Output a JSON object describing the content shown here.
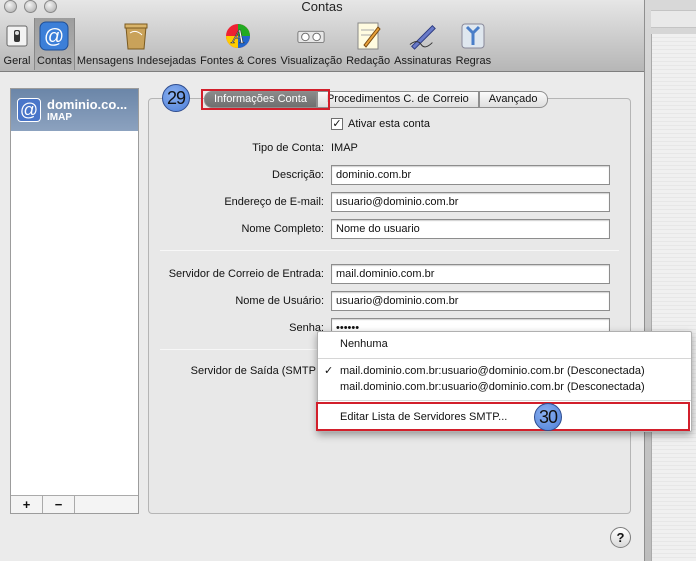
{
  "window": {
    "title": "Contas"
  },
  "toolbar": {
    "items": [
      {
        "label": "Geral",
        "icon": "switch-icon"
      },
      {
        "label": "Contas",
        "icon": "at-icon",
        "selected": true
      },
      {
        "label": "Mensagens Indesejadas",
        "icon": "trash-bin-icon"
      },
      {
        "label": "Fontes & Cores",
        "icon": "color-font-icon"
      },
      {
        "label": "Visualização",
        "icon": "glasses-icon"
      },
      {
        "label": "Redação",
        "icon": "compose-icon"
      },
      {
        "label": "Assinaturas",
        "icon": "pen-icon"
      },
      {
        "label": "Regras",
        "icon": "rules-icon"
      }
    ]
  },
  "sidebar": {
    "account": {
      "name": "dominio.co...",
      "type": "IMAP"
    },
    "add_label": "+",
    "remove_label": "−"
  },
  "badges": {
    "tab_step": "29",
    "menu_step": "30"
  },
  "tabs": [
    {
      "label": "Informações Conta",
      "active": true
    },
    {
      "label": "Procedimentos C. de Correio"
    },
    {
      "label": "Avançado"
    }
  ],
  "form": {
    "enable_label": "Ativar esta conta",
    "enable_checked": true,
    "account_type_label": "Tipo de Conta:",
    "account_type_value": "IMAP",
    "description_label": "Descrição:",
    "description_value": "dominio.com.br",
    "email_label": "Endereço de E-mail:",
    "email_value": "usuario@dominio.com.br",
    "fullname_label": "Nome Completo:",
    "fullname_value": "Nome do usuario",
    "incoming_label": "Servidor de Correio de Entrada:",
    "incoming_value": "mail.dominio.com.br",
    "username_label": "Nome de Usuário:",
    "username_value": "usuario@dominio.com.br",
    "password_label": "Senha:",
    "password_value": "••••••",
    "smtp_label": "Servidor de Saída (SMTP"
  },
  "smtp_menu": {
    "none": "Nenhuma",
    "selected_mark": "✓",
    "server1": "mail.dominio.com.br:usuario@dominio.com.br (Desconectada)",
    "server2": "mail.dominio.com.br:usuario@dominio.com.br (Desconectada)",
    "edit": "Editar Lista de Servidores SMTP..."
  },
  "help": "?",
  "colors": {
    "highlight": "#d21f2b",
    "badge": "#5b8de0"
  }
}
